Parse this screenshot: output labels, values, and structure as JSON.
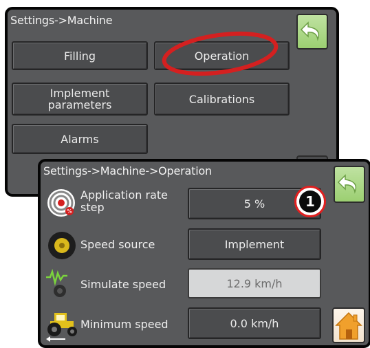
{
  "machine_screen": {
    "title": "Settings->Machine",
    "buttons": {
      "filling": "Filling",
      "operation": "Operation",
      "implement_parameters_line1": "Implement",
      "implement_parameters_line2": "parameters",
      "calibrations": "Calibrations",
      "alarms": "Alarms"
    }
  },
  "operation_screen": {
    "title": "Settings->Machine->Operation",
    "rows": {
      "application_rate_step": {
        "label_line1": "Application rate",
        "label_line2": "step",
        "value": "5 %"
      },
      "speed_source": {
        "label": "Speed source",
        "value": "Implement"
      },
      "simulate_speed": {
        "label": "Simulate speed",
        "value": "12.9 km/h"
      },
      "minimum_speed": {
        "label": "Minimum speed",
        "value": "0.0 km/h"
      }
    }
  },
  "callout": {
    "number": "1"
  },
  "colors": {
    "panel_bg": "#58595b",
    "button_bg": "#4b4c4e",
    "highlight_ring": "#e02020",
    "back_arrow": "#ffffff",
    "back_button_bg": "#a8d47f"
  },
  "icons": [
    "back-arrow-icon",
    "home-icon",
    "application-rate-target-icon",
    "speed-source-wheel-icon",
    "simulate-speed-wave-icon",
    "minimum-speed-tractor-icon"
  ]
}
